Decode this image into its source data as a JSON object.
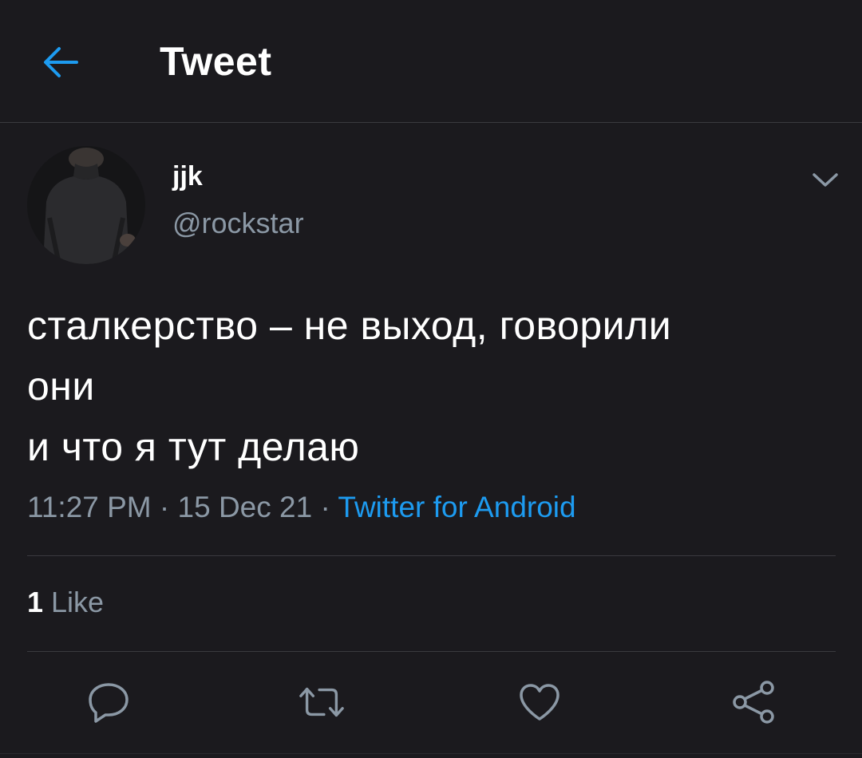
{
  "header": {
    "title": "Tweet",
    "back_icon": "arrow-left-icon"
  },
  "author": {
    "display_name": "jjk",
    "handle": "@rockstar",
    "menu_icon": "chevron-down-icon"
  },
  "tweet": {
    "lines": [
      "сталкерство – не выход, говорили",
      "они",
      "и что я тут делаю"
    ],
    "time": "11:27 PM",
    "date": "15 Dec 21",
    "separator": " · ",
    "source": "Twitter for Android"
  },
  "stats": {
    "likes_count": "1",
    "likes_label": "Like"
  },
  "actions": {
    "reply_icon": "reply-icon",
    "retweet_icon": "retweet-icon",
    "like_icon": "heart-icon",
    "share_icon": "share-icon"
  },
  "colors": {
    "background": "#1b1a1e",
    "accent": "#1d9bf0",
    "secondary_text": "#8b98a5",
    "divider": "#3a3a3f"
  }
}
